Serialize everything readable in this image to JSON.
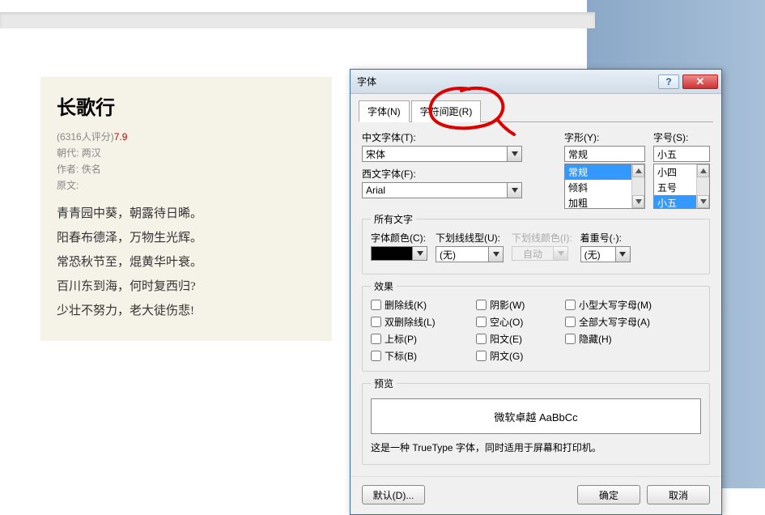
{
  "article": {
    "title": "长歌行",
    "rating_meta": "(6316人评分)",
    "rating": "7.9",
    "dynasty_label": "朝代:",
    "dynasty": "两汉",
    "author_label": "作者:",
    "author": "佚名",
    "original_label": "原文:",
    "lines": [
      "青青园中葵，朝露待日晞。",
      "阳春布德泽，万物生光辉。",
      "常恐秋节至，焜黄华叶衰。",
      "百川东到海，何时复西归?",
      "少壮不努力，老大徒伤悲!"
    ]
  },
  "dialog": {
    "title": "字体",
    "tabs": {
      "font": "字体(N)",
      "spacing": "字符间距(R)"
    },
    "labels": {
      "cjk_font": "中文字体(T):",
      "latin_font": "西文字体(F):",
      "style": "字形(Y):",
      "size": "字号(S):",
      "all_text": "所有文字",
      "font_color": "字体颜色(C):",
      "underline_style": "下划线线型(U):",
      "underline_color": "下划线颜色(I):",
      "emphasis": "着重号(·):",
      "effects": "效果",
      "preview": "预览",
      "none": "(无)",
      "auto": "自动"
    },
    "values": {
      "cjk_font": "宋体",
      "latin_font": "Arial",
      "style": "常规",
      "size": "小五",
      "underline": "(无)",
      "emphasis": "(无)"
    },
    "style_options": [
      "常规",
      "倾斜",
      "加粗"
    ],
    "size_options": [
      "小四",
      "五号",
      "小五"
    ],
    "effects_options": {
      "strikethrough": "删除线(K)",
      "double_strikethrough": "双删除线(L)",
      "superscript": "上标(P)",
      "subscript": "下标(B)",
      "shadow": "阴影(W)",
      "outline": "空心(O)",
      "emboss": "阳文(E)",
      "engrave": "阴文(G)",
      "small_caps": "小型大写字母(M)",
      "all_caps": "全部大写字母(A)",
      "hidden": "隐藏(H)"
    },
    "preview_text": "微软卓越 AaBbCc",
    "preview_note": "这是一种 TrueType 字体，同时适用于屏幕和打印机。",
    "buttons": {
      "default": "默认(D)...",
      "ok": "确定",
      "cancel": "取消"
    }
  }
}
